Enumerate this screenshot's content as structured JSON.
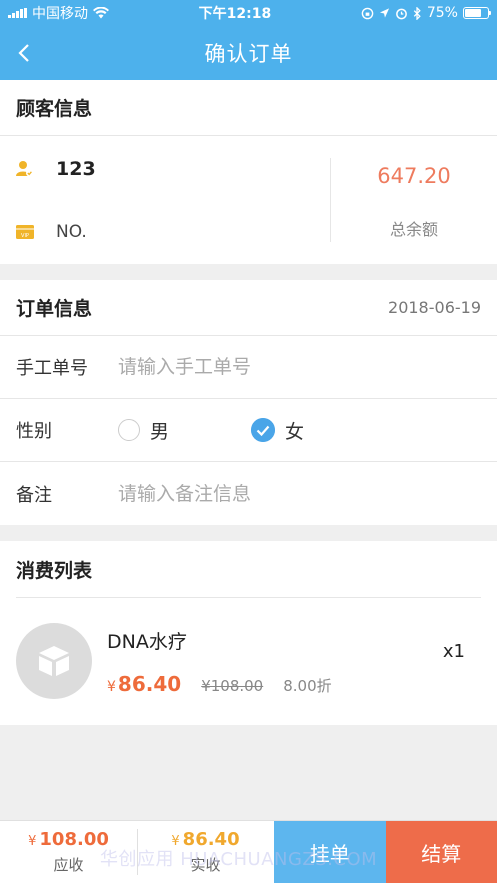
{
  "status_bar": {
    "carrier": "中国移动",
    "time": "下午12:18",
    "battery": "75%",
    "battery_level": 0.75
  },
  "header": {
    "title": "确认订单"
  },
  "customer": {
    "section_title": "顾客信息",
    "name": "123",
    "card_no": "NO.",
    "balance": "647.20",
    "balance_label": "总余额"
  },
  "order": {
    "section_title": "订单信息",
    "date": "2018-06-19",
    "manual_no_label": "手工单号",
    "manual_no_placeholder": "请输入手工单号",
    "gender_label": "性别",
    "gender_male": "男",
    "gender_female": "女",
    "gender_selected": "女",
    "note_label": "备注",
    "note_placeholder": "请输入备注信息"
  },
  "consumption": {
    "section_title": "消费列表",
    "items": [
      {
        "name": "DNA水疗",
        "currency": "¥",
        "price": "86.40",
        "original_price": "¥108.00",
        "discount": "8.00折",
        "quantity": "x1"
      }
    ]
  },
  "footer": {
    "receivable_currency": "¥",
    "receivable": "108.00",
    "receivable_label": "应收",
    "received_currency": "¥",
    "received": "86.40",
    "received_label": "实收",
    "hold_label": "挂单",
    "checkout_label": "结算"
  },
  "watermark": "华创应用 HUACHUANGZS.COM",
  "colors": {
    "header_bg": "#4db1ec",
    "accent_orange": "#ee6b3b",
    "receivable_color": "#ee6b3b",
    "received_color": "#f0a82e",
    "hold_button": "#5db6ee",
    "checkout_button": "#ee6c4a"
  }
}
